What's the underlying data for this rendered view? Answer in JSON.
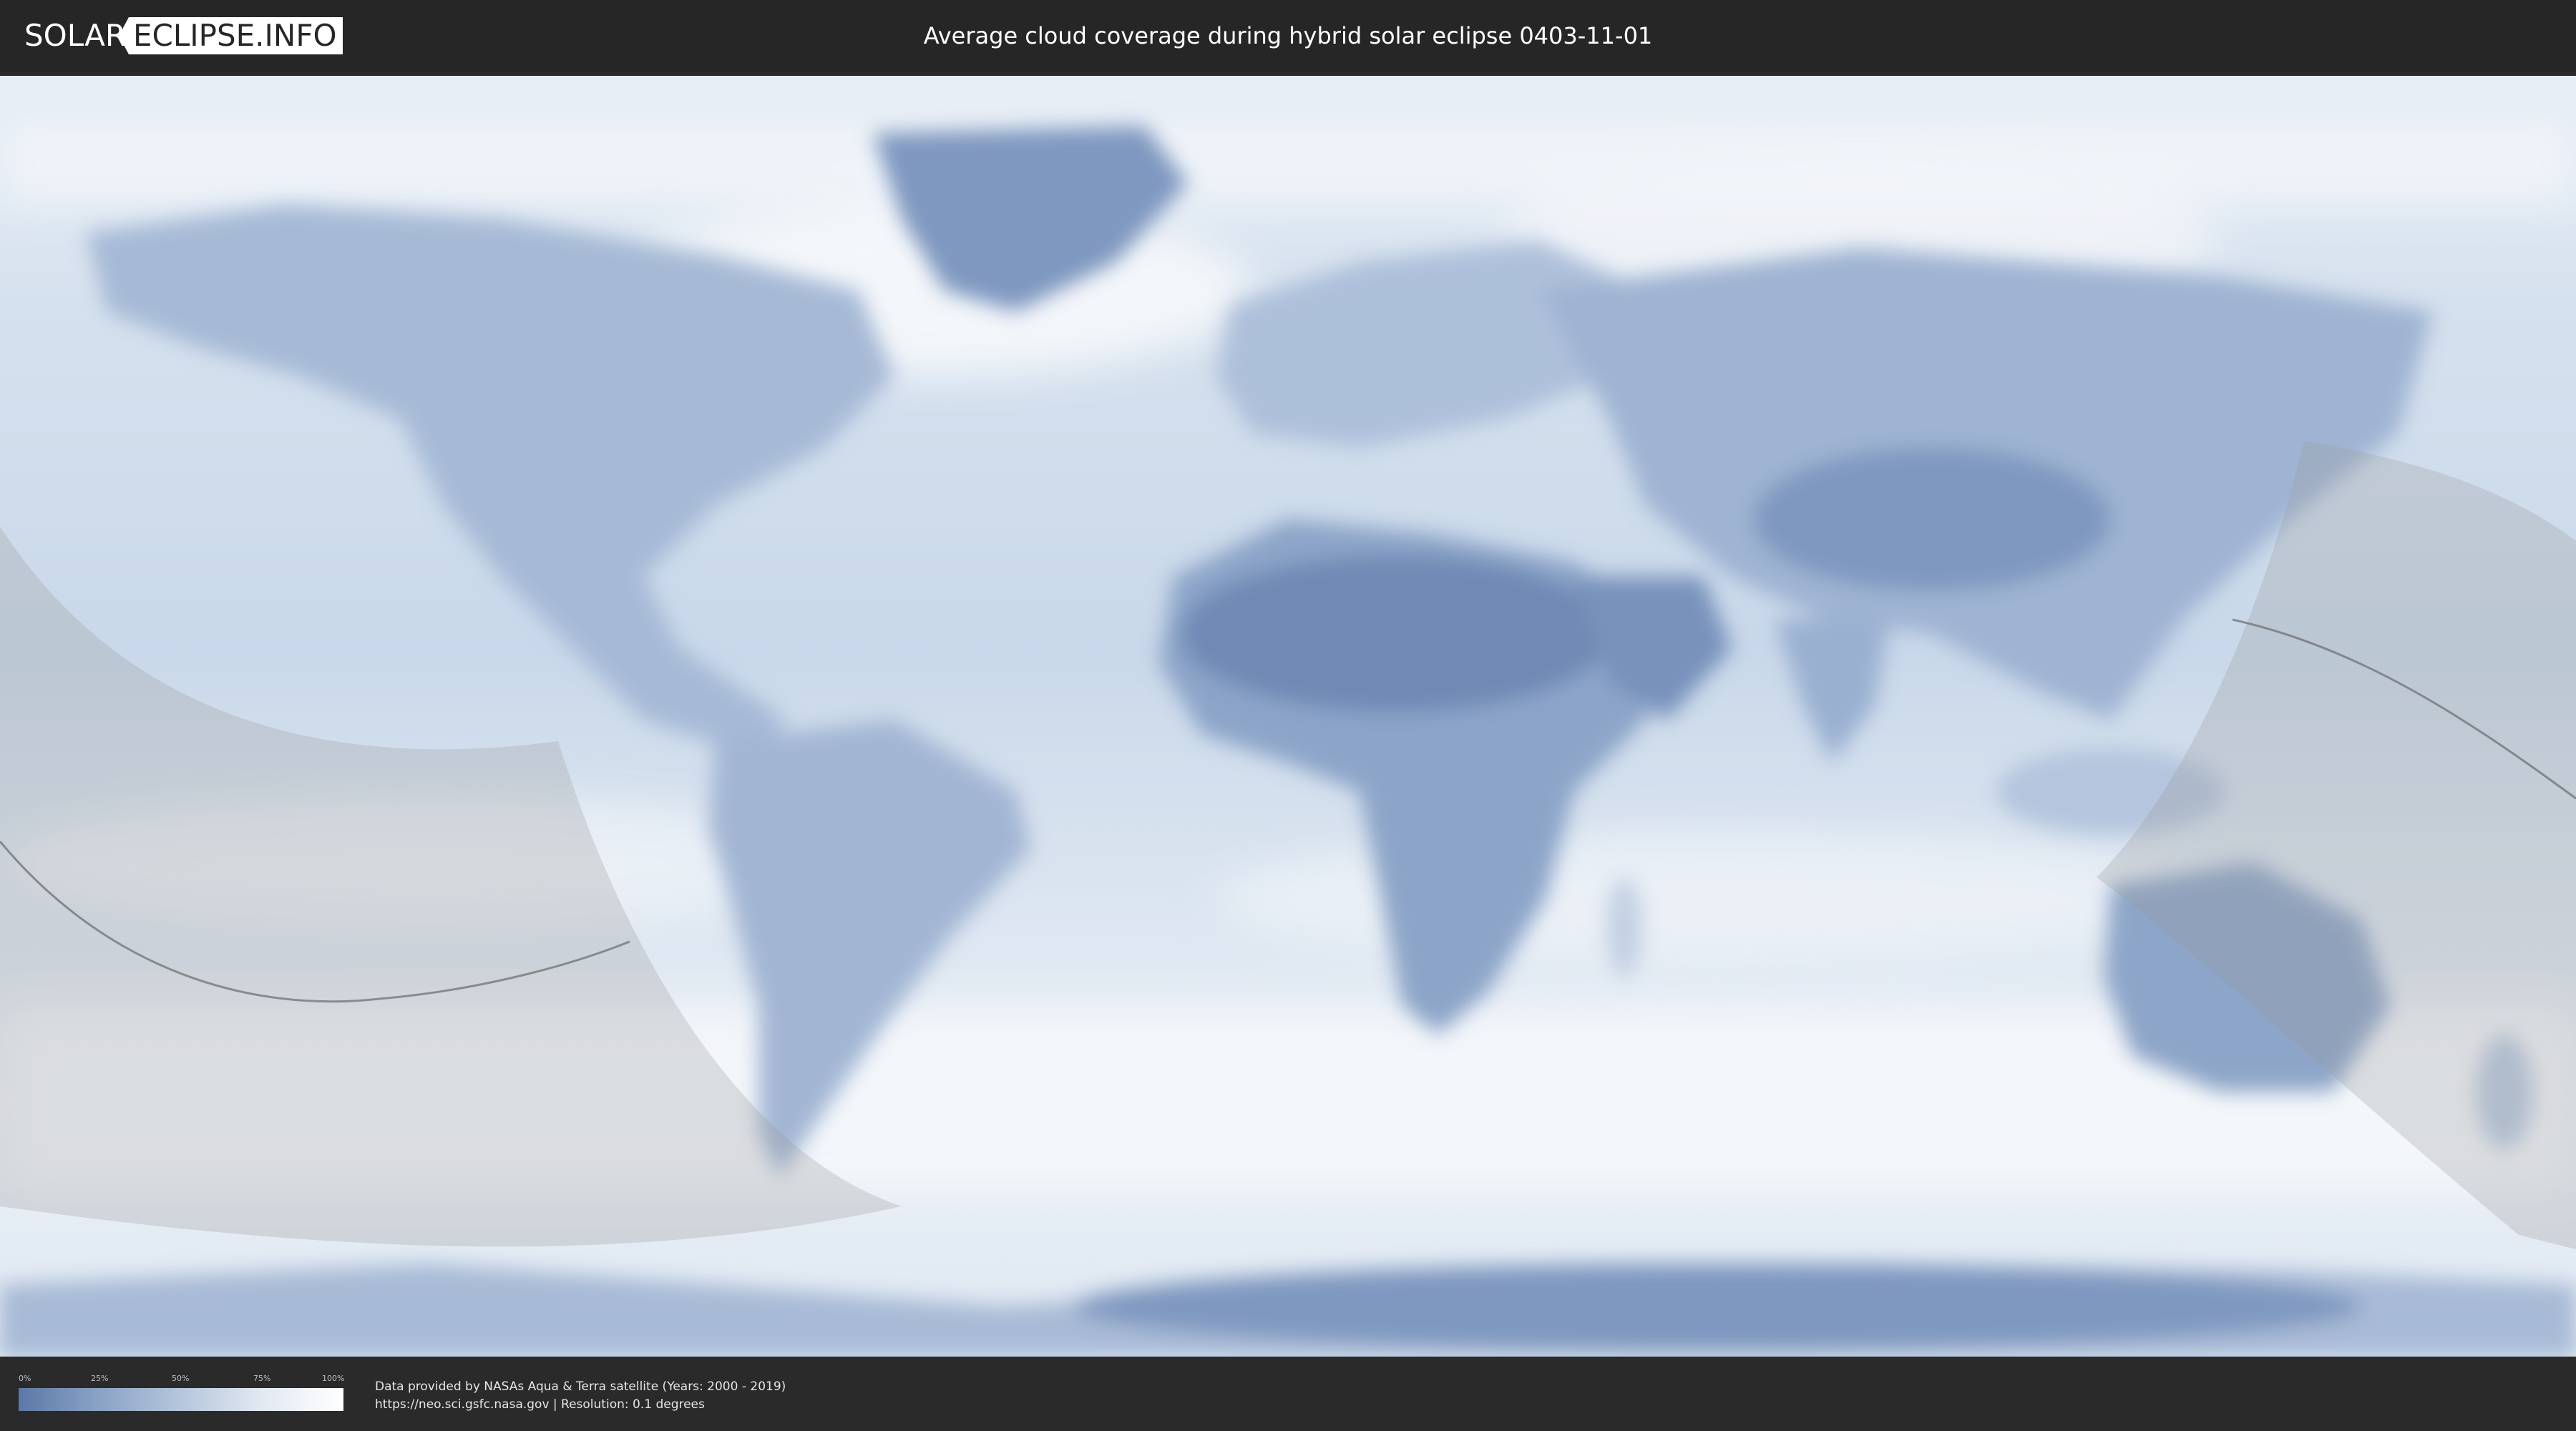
{
  "header": {
    "logo_part1": "SOLAR",
    "logo_part2": "ECLIPSE.INFO",
    "title": "Average cloud coverage during hybrid solar eclipse 0403-11-01"
  },
  "legend": {
    "ticks": [
      "0%",
      "25%",
      "50%",
      "75%",
      "100%"
    ],
    "color_low": "#5b79a8",
    "color_high": "#ffffff"
  },
  "footer": {
    "attribution_line1": "Data provided by NASAs Aqua & Terra satellite (Years: 2000 - 2019)",
    "attribution_line2": "https://neo.sci.gsfc.nasa.gov | Resolution: 0.1 degrees"
  },
  "colors": {
    "cloud_clear": "#5b79a8",
    "cloud_full": "#ffffff",
    "eclipse_overlay": "#b8b8b8"
  }
}
